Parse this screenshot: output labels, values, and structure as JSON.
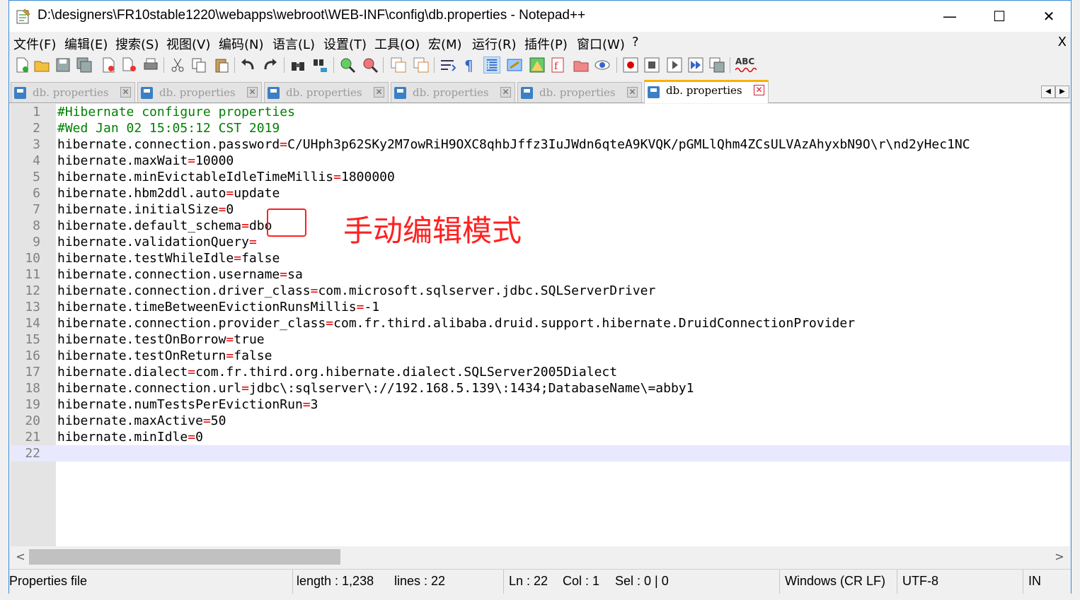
{
  "window": {
    "title": "D:\\designers\\FR10stable1220\\webapps\\webroot\\WEB-INF\\config\\db.properties - Notepad++",
    "minimize": "—",
    "maximize": "☐",
    "close": "✕"
  },
  "menu": {
    "items": [
      "文件(F)",
      "编辑(E)",
      "搜索(S)",
      "视图(V)",
      "编码(N)",
      "语言(L)",
      "设置(T)",
      "工具(O)",
      "宏(M)",
      "运行(R)",
      "插件(P)",
      "窗口(W)",
      "?"
    ],
    "close_doc": "X"
  },
  "toolbar": {
    "spellcheck_label": "ABC"
  },
  "tabs": [
    {
      "label": "db. properties",
      "close": "✕",
      "active": false
    },
    {
      "label": "db. properties",
      "close": "✕",
      "active": false
    },
    {
      "label": "db. properties",
      "close": "✕",
      "active": false
    },
    {
      "label": "db. properties",
      "close": "✕",
      "active": false
    },
    {
      "label": "db. properties",
      "close": "✕",
      "active": false
    },
    {
      "label": "db. properties",
      "close": "✕",
      "active": true
    }
  ],
  "tab_nav": {
    "left": "◀",
    "right": "▶"
  },
  "editor": {
    "lines": [
      {
        "n": "1",
        "type": "comment",
        "text": "#Hibernate configure properties"
      },
      {
        "n": "2",
        "type": "comment",
        "text": "#Wed Jan 02 15:05:12 CST 2019"
      },
      {
        "n": "3",
        "key": "hibernate.connection.password",
        "value": "C/UHph3p62SKy2M7owRiH9OXC8qhbJffz3IuJWdn6qteA9KVQK/pGMLlQhm4ZCsULVAzAhyxbN9O\\r\\nd2yHec1NC"
      },
      {
        "n": "4",
        "key": "hibernate.maxWait",
        "value": "10000"
      },
      {
        "n": "5",
        "key": "hibernate.minEvictableIdleTimeMillis",
        "value": "1800000"
      },
      {
        "n": "6",
        "key": "hibernate.hbm2ddl.auto",
        "value": "update"
      },
      {
        "n": "7",
        "key": "hibernate.initialSize",
        "value": "0"
      },
      {
        "n": "8",
        "key": "hibernate.default_schema",
        "value": "dbo"
      },
      {
        "n": "9",
        "key": "hibernate.validationQuery",
        "value": ""
      },
      {
        "n": "10",
        "key": "hibernate.testWhileIdle",
        "value": "false"
      },
      {
        "n": "11",
        "key": "hibernate.connection.username",
        "value": "sa"
      },
      {
        "n": "12",
        "key": "hibernate.connection.driver_class",
        "value": "com.microsoft.sqlserver.jdbc.SQLServerDriver"
      },
      {
        "n": "13",
        "key": "hibernate.timeBetweenEvictionRunsMillis",
        "value": "-1"
      },
      {
        "n": "14",
        "key": "hibernate.connection.provider_class",
        "value": "com.fr.third.alibaba.druid.support.hibernate.DruidConnectionProvider"
      },
      {
        "n": "15",
        "key": "hibernate.testOnBorrow",
        "value": "true"
      },
      {
        "n": "16",
        "key": "hibernate.testOnReturn",
        "value": "false"
      },
      {
        "n": "17",
        "key": "hibernate.dialect",
        "value": "com.fr.third.org.hibernate.dialect.SQLServer2005Dialect"
      },
      {
        "n": "18",
        "key": "hibernate.connection.url",
        "value": "jdbc\\:sqlserver\\://192.168.5.139\\:1434;DatabaseName\\=abby1"
      },
      {
        "n": "19",
        "key": "hibernate.numTestsPerEvictionRun",
        "value": "3"
      },
      {
        "n": "20",
        "key": "hibernate.maxActive",
        "value": "50"
      },
      {
        "n": "21",
        "key": "hibernate.minIdle",
        "value": "0"
      },
      {
        "n": "22",
        "type": "empty",
        "text": ""
      }
    ],
    "eq_symbol": "="
  },
  "annotation": {
    "text": "手动编辑模式",
    "color": "#ff2020"
  },
  "scrollbar": {
    "left": "<",
    "right": ">"
  },
  "status": {
    "filetype": "Properties file",
    "length": "length : 1,238",
    "lines": "lines : 22",
    "ln": "Ln : 22",
    "col": "Col : 1",
    "sel": "Sel : 0 | 0",
    "eol": "Windows (CR LF)",
    "encoding": "UTF-8",
    "mode": "IN"
  }
}
